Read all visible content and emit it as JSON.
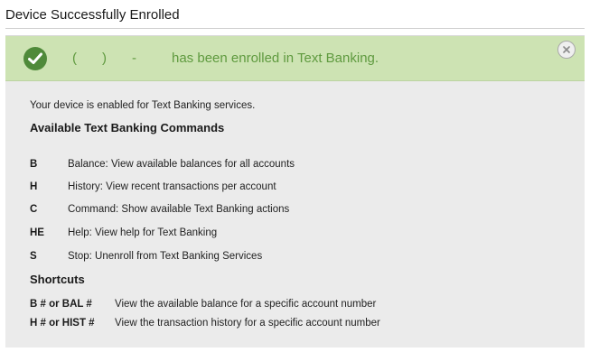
{
  "dialog": {
    "title": "Device Successfully Enrolled"
  },
  "alert": {
    "phone_parts": [
      "(",
      ")",
      "-"
    ],
    "message": "has been enrolled in Text Banking.",
    "colors": {
      "background": "#cde3b3",
      "text": "#5f9a3f",
      "icon": "#4f8a3a"
    },
    "icons": {
      "status": "check-circle-icon",
      "close": "close-circle-icon"
    }
  },
  "content": {
    "intro": "Your device is enabled for Text Banking services.",
    "commands_heading": "Available Text Banking Commands",
    "commands": [
      {
        "key": "B",
        "description": "Balance: View available balances for all accounts"
      },
      {
        "key": "H",
        "description": "History: View recent transactions per account"
      },
      {
        "key": "C",
        "description": "Command: Show available Text Banking actions"
      },
      {
        "key": "HE",
        "description": "Help: View help for Text Banking"
      },
      {
        "key": "S",
        "description": "Stop: Unenroll from Text Banking Services"
      }
    ],
    "shortcuts_heading": "Shortcuts",
    "shortcuts": [
      {
        "key": "B # or BAL #",
        "description": "View the available balance for a specific account number"
      },
      {
        "key": "H # or HIST #",
        "description": "View the transaction history for a specific account number"
      }
    ]
  }
}
